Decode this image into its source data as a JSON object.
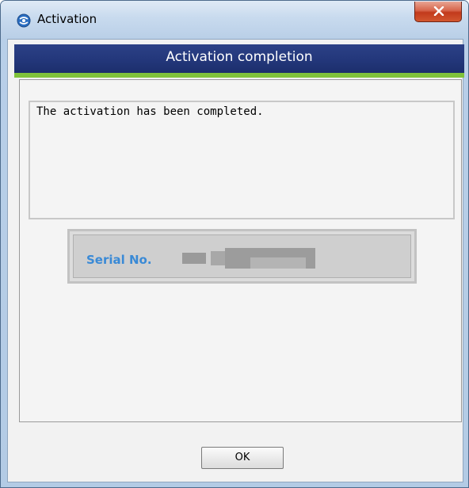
{
  "window": {
    "title": "Activation",
    "app_icon": "activation-globe-icon",
    "close_icon": "close-icon"
  },
  "header": {
    "title": "Activation completion"
  },
  "message": {
    "text": "The activation has been completed."
  },
  "serial": {
    "label": "Serial No.",
    "value_state": "redacted"
  },
  "footer": {
    "ok_label": "OK"
  },
  "colors": {
    "header_band": "#24387c",
    "header_accent": "#7fc23a",
    "serial_label": "#3a8ad6",
    "close_button": "#c23a1c"
  }
}
